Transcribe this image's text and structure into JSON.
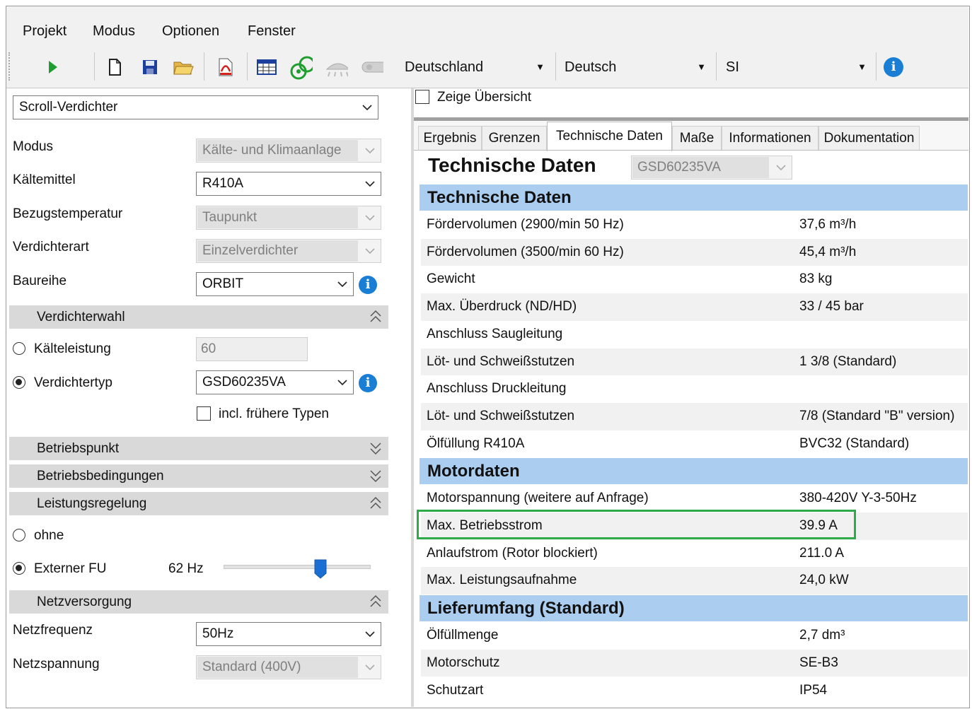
{
  "menu": [
    "Projekt",
    "Modus",
    "Optionen",
    "Fenster"
  ],
  "toolbar": {
    "country": "Deutschland",
    "language": "Deutsch",
    "units": "SI"
  },
  "left": {
    "compressor_kind": "Scroll-Verdichter",
    "fields": [
      {
        "label": "Modus",
        "value": "Kälte- und Klimaanlage",
        "disabled": true
      },
      {
        "label": "Kältemittel",
        "value": "R410A",
        "disabled": false
      },
      {
        "label": "Bezugstemperatur",
        "value": "Taupunkt",
        "disabled": true
      },
      {
        "label": "Verdichterart",
        "value": "Einzelverdichter",
        "disabled": true
      },
      {
        "label": "Baureihe",
        "value": "ORBIT",
        "disabled": false
      }
    ],
    "sections": {
      "verdichterwahl": "Verdichterwahl",
      "betriebspunkt": "Betriebspunkt",
      "betriebsbedingungen": "Betriebsbedingungen",
      "leistungsregelung": "Leistungsregelung",
      "netzversorgung": "Netzversorgung"
    },
    "kaelteleistung": {
      "label": "Kälteleistung",
      "value": "60",
      "selected": false
    },
    "verdichtertyp": {
      "label": "Verdichtertyp",
      "value": "GSD60235VA",
      "selected": true
    },
    "incl_frueher": {
      "label": "incl. frühere Typen",
      "checked": false
    },
    "ohne": {
      "label": "ohne",
      "selected": false
    },
    "externer_fu": {
      "label": "Externer FU",
      "hz": "62 Hz",
      "selected": true,
      "slider_fraction": 0.66
    },
    "netzfrequenz": {
      "label": "Netzfrequenz",
      "value": "50Hz"
    },
    "netzspannung": {
      "label": "Netzspannung",
      "value": "Standard (400V)"
    }
  },
  "right": {
    "zeige_uebersicht": "Zeige Übersicht",
    "tabs": [
      "Ergebnis",
      "Grenzen",
      "Technische Daten",
      "Maße",
      "Informationen",
      "Dokumentation"
    ],
    "active_tab": "Technische Daten",
    "title": "Technische Daten",
    "model": "GSD60235VA",
    "groups": [
      {
        "header": "Technische Daten",
        "rows": [
          {
            "k": "Fördervolumen (2900/min 50 Hz)",
            "v": "37,6 m³/h"
          },
          {
            "k": "Fördervolumen (3500/min 60 Hz)",
            "v": "45,4 m³/h"
          },
          {
            "k": "Gewicht",
            "v": "83 kg"
          },
          {
            "k": "Max. Überdruck (ND/HD)",
            "v": "33 / 45 bar"
          },
          {
            "k": "Anschluss Saugleitung",
            "v": ""
          },
          {
            "k": "Löt- und Schweißstutzen",
            "v": "1 3/8 (Standard)"
          },
          {
            "k": "Anschluss Druckleitung",
            "v": ""
          },
          {
            "k": "Löt- und Schweißstutzen",
            "v": "7/8 (Standard \"B\" version)"
          },
          {
            "k": "Ölfüllung R410A",
            "v": "BVC32 (Standard)"
          }
        ]
      },
      {
        "header": "Motordaten",
        "rows": [
          {
            "k": "Motorspannung (weitere auf Anfrage)",
            "v": "380-420V Y-3-50Hz"
          },
          {
            "k": "Max. Betriebsstrom",
            "v": "39.9 A"
          },
          {
            "k": "Anlaufstrom (Rotor blockiert)",
            "v": "211.0 A"
          },
          {
            "k": "Max. Leistungsaufnahme",
            "v": "24,0 kW"
          }
        ]
      },
      {
        "header": "Lieferumfang (Standard)",
        "rows": [
          {
            "k": "Ölfüllmenge",
            "v": "2,7 dm³"
          },
          {
            "k": "Motorschutz",
            "v": "SE-B3"
          },
          {
            "k": "Schutzart",
            "v": "IP54"
          }
        ]
      }
    ],
    "highlight_color": "#2eaa4a",
    "header_color": "#abcdf0"
  }
}
